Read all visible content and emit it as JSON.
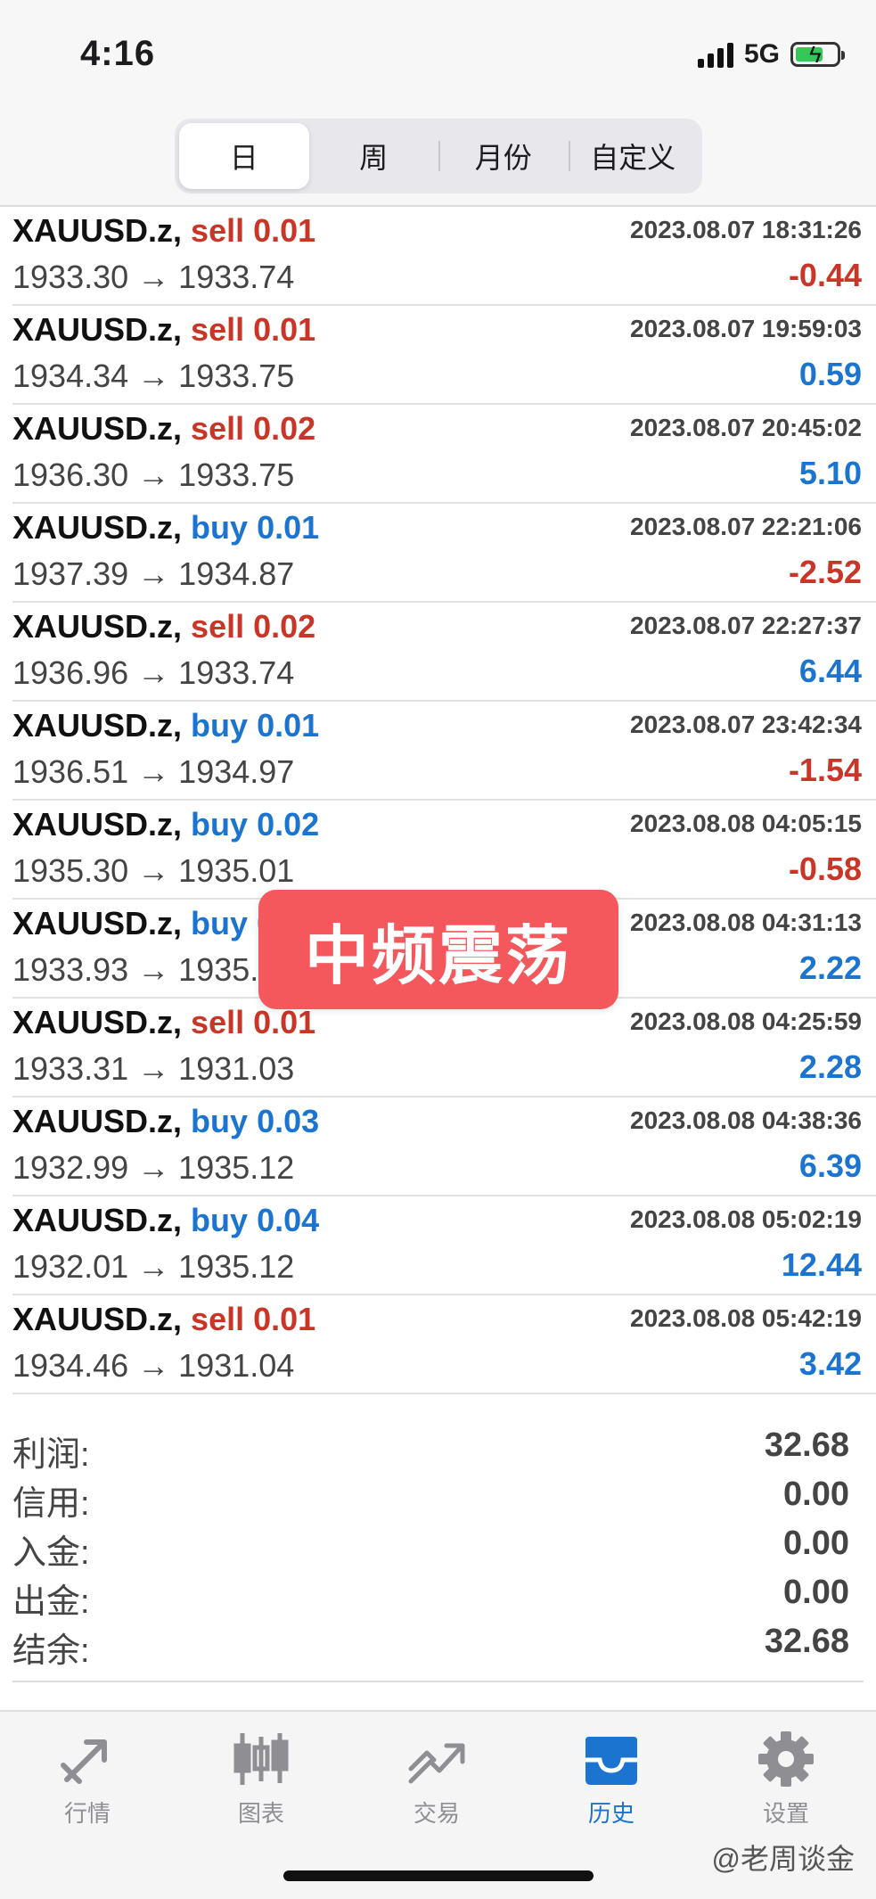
{
  "status": {
    "time": "4:16",
    "network": "5G"
  },
  "segments": [
    {
      "label": "日",
      "active": true
    },
    {
      "label": "周",
      "active": false
    },
    {
      "label": "月份",
      "active": false
    },
    {
      "label": "自定义",
      "active": false
    }
  ],
  "trades": [
    {
      "symbol": "XAUUSD.z,",
      "side": "sell",
      "volume": "0.01",
      "time": "2023.08.07 18:31:26",
      "open": "1933.30",
      "close": "1933.74",
      "profit": "-0.44"
    },
    {
      "symbol": "XAUUSD.z,",
      "side": "sell",
      "volume": "0.01",
      "time": "2023.08.07 19:59:03",
      "open": "1934.34",
      "close": "1933.75",
      "profit": "0.59"
    },
    {
      "symbol": "XAUUSD.z,",
      "side": "sell",
      "volume": "0.02",
      "time": "2023.08.07 20:45:02",
      "open": "1936.30",
      "close": "1933.75",
      "profit": "5.10"
    },
    {
      "symbol": "XAUUSD.z,",
      "side": "buy",
      "volume": "0.01",
      "time": "2023.08.07 22:21:06",
      "open": "1937.39",
      "close": "1934.87",
      "profit": "-2.52"
    },
    {
      "symbol": "XAUUSD.z,",
      "side": "sell",
      "volume": "0.02",
      "time": "2023.08.07 22:27:37",
      "open": "1936.96",
      "close": "1933.74",
      "profit": "6.44"
    },
    {
      "symbol": "XAUUSD.z,",
      "side": "buy",
      "volume": "0.01",
      "time": "2023.08.07 23:42:34",
      "open": "1936.51",
      "close": "1934.97",
      "profit": "-1.54"
    },
    {
      "symbol": "XAUUSD.z,",
      "side": "buy",
      "volume": "0.02",
      "time": "2023.08.08 04:05:15",
      "open": "1935.30",
      "close": "1935.01",
      "profit": "-0.58"
    },
    {
      "symbol": "XAUUSD.z,",
      "side": "buy",
      "volume": "0.02",
      "time": "2023.08.08 04:31:13",
      "open": "1933.93",
      "close": "1935.04",
      "profit": "2.22"
    },
    {
      "symbol": "XAUUSD.z,",
      "side": "sell",
      "volume": "0.01",
      "time": "2023.08.08 04:25:59",
      "open": "1933.31",
      "close": "1931.03",
      "profit": "2.28"
    },
    {
      "symbol": "XAUUSD.z,",
      "side": "buy",
      "volume": "0.03",
      "time": "2023.08.08 04:38:36",
      "open": "1932.99",
      "close": "1935.12",
      "profit": "6.39"
    },
    {
      "symbol": "XAUUSD.z,",
      "side": "buy",
      "volume": "0.04",
      "time": "2023.08.08 05:02:19",
      "open": "1932.01",
      "close": "1935.12",
      "profit": "12.44"
    },
    {
      "symbol": "XAUUSD.z,",
      "side": "sell",
      "volume": "0.01",
      "time": "2023.08.08 05:42:19",
      "open": "1934.46",
      "close": "1931.04",
      "profit": "3.42"
    }
  ],
  "arrow": "→",
  "summary": [
    {
      "label": "利润:",
      "value": "32.68"
    },
    {
      "label": "信用:",
      "value": "0.00"
    },
    {
      "label": "入金:",
      "value": "0.00"
    },
    {
      "label": "出金:",
      "value": "0.00"
    },
    {
      "label": "结余:",
      "value": "32.68"
    }
  ],
  "banner": "中频震荡",
  "tabs": [
    {
      "label": "行情",
      "icon": "quotes-icon",
      "active": false
    },
    {
      "label": "图表",
      "icon": "chart-icon",
      "active": false
    },
    {
      "label": "交易",
      "icon": "trade-icon",
      "active": false
    },
    {
      "label": "历史",
      "icon": "history-icon",
      "active": true
    },
    {
      "label": "设置",
      "icon": "settings-icon",
      "active": false
    }
  ],
  "watermark": "@老周谈金",
  "colors": {
    "sell": "#c93527",
    "buy": "#1b75d0",
    "active_tab": "#1b75d0"
  }
}
